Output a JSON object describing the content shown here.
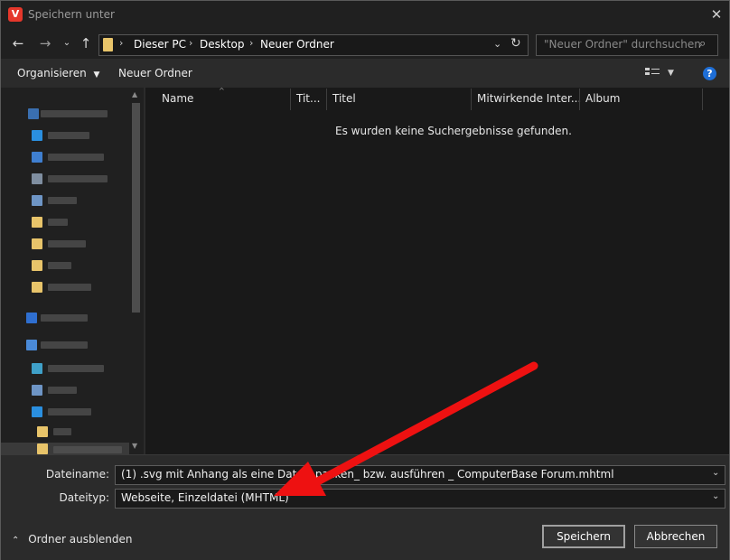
{
  "window": {
    "title": "Speichern unter",
    "app_icon_letter": "V"
  },
  "nav": {
    "breadcrumbs": [
      "Dieser PC",
      "Desktop",
      "Neuer Ordner"
    ],
    "search_placeholder": "\"Neuer Ordner\" durchsuchen"
  },
  "toolbar": {
    "organize": "Organisieren",
    "new_folder": "Neuer Ordner",
    "help": "?"
  },
  "columns": [
    "Name",
    "Tit...",
    "Titel",
    "Mitwirkende Inter...",
    "Album"
  ],
  "file_list": {
    "empty_message": "Es wurden keine Suchergebnisse gefunden."
  },
  "form": {
    "filename_label": "Dateiname:",
    "filename_value": "(1) .svg mit Anhang als eine Datei _packen_ bzw. ausführen _ ComputerBase Forum.mhtml",
    "filetype_label": "Dateityp:",
    "filetype_value": "Webseite, Einzeldatei (MHTML)"
  },
  "footer": {
    "hide_folders": "Ordner ausblenden",
    "save": "Speichern",
    "cancel": "Abbrechen"
  },
  "colors": {
    "accent_red": "#e5372b",
    "help_blue": "#1e6ed6",
    "folder_yellow": "#e8c46a"
  }
}
